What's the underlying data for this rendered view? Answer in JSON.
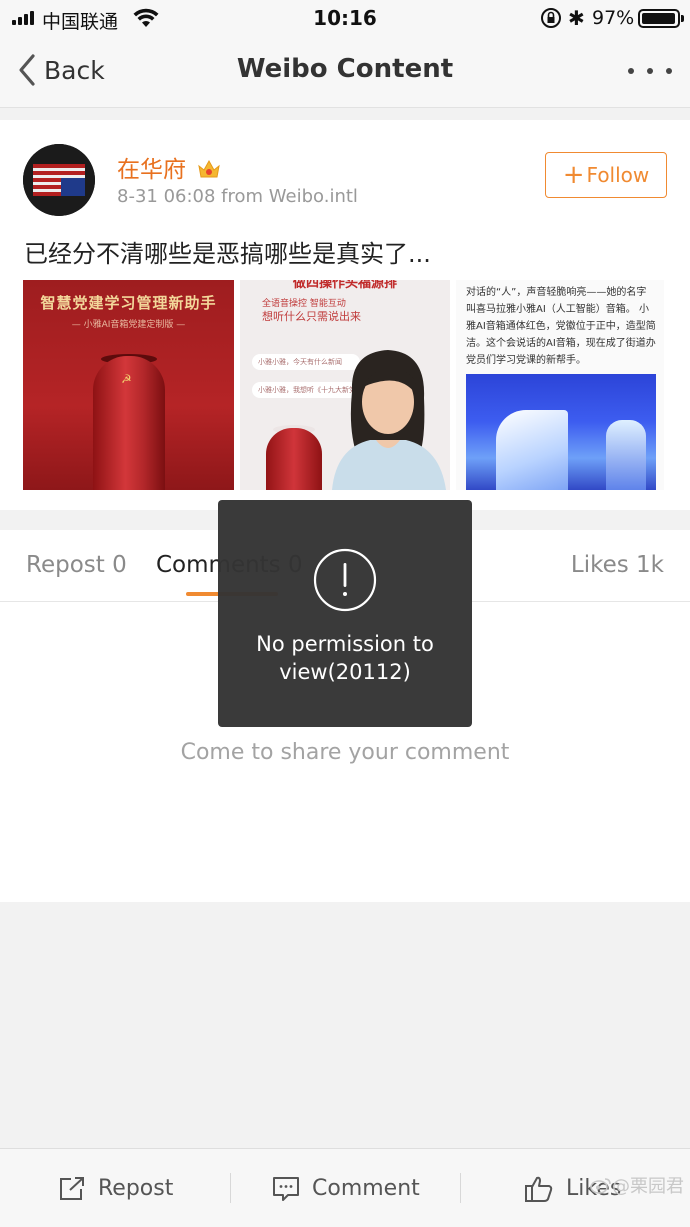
{
  "status_bar": {
    "carrier": "中国联通",
    "time": "10:16",
    "battery_percent": "97%",
    "battery_level": 0.97,
    "icons": [
      "signal-icon",
      "wifi-icon",
      "orientation-lock-icon",
      "bluetooth-icon",
      "battery-icon"
    ]
  },
  "nav": {
    "back_label": "Back",
    "title": "Weibo Content",
    "icons": [
      "chevron-left-icon",
      "more-icon"
    ]
  },
  "post": {
    "username": "在华府",
    "meta": "8-31 06:08  from Weibo.intl",
    "follow_label": "Follow",
    "text": "已经分不清哪些是恶搞哪些是真实了...",
    "images": [
      {
        "title": "智慧党建学习管理新助手",
        "subtitle": "— 小雅AI音箱党建定制版 —"
      },
      {
        "heading": "做四操作头福源排",
        "line1": "全语音操控  智能互动",
        "line2": "想听什么只需说出来",
        "bubble1": "小雅小雅，今天有什么新闻",
        "bubble2": "小雅小雅，我想听《十九大新党章》"
      },
      {
        "text": "对话的“人”，声音轻脆响亮——她的名字叫喜马拉雅小雅AI（人工智能）音箱。  小雅AI音箱通体红色，党徽位于正中，造型简洁。这个会说话的AI音箱，现在成了街道办党员们学习党课的新帮手。"
      }
    ]
  },
  "tabs": {
    "repost": "Repost 0",
    "comments": "Comments 0",
    "likes": "Likes 1k"
  },
  "comments": {
    "empty_text": "Come to share your comment"
  },
  "toast": {
    "message": "No permission to view(20112)",
    "icon": "exclamation-icon"
  },
  "toolbar": {
    "repost_label": "Repost",
    "comment_label": "Comment",
    "likes_label": "Likes"
  },
  "watermark": "@栗园君",
  "colors": {
    "accent": "#f08a31",
    "username": "#e8711f",
    "toast_bg": "#343434"
  }
}
